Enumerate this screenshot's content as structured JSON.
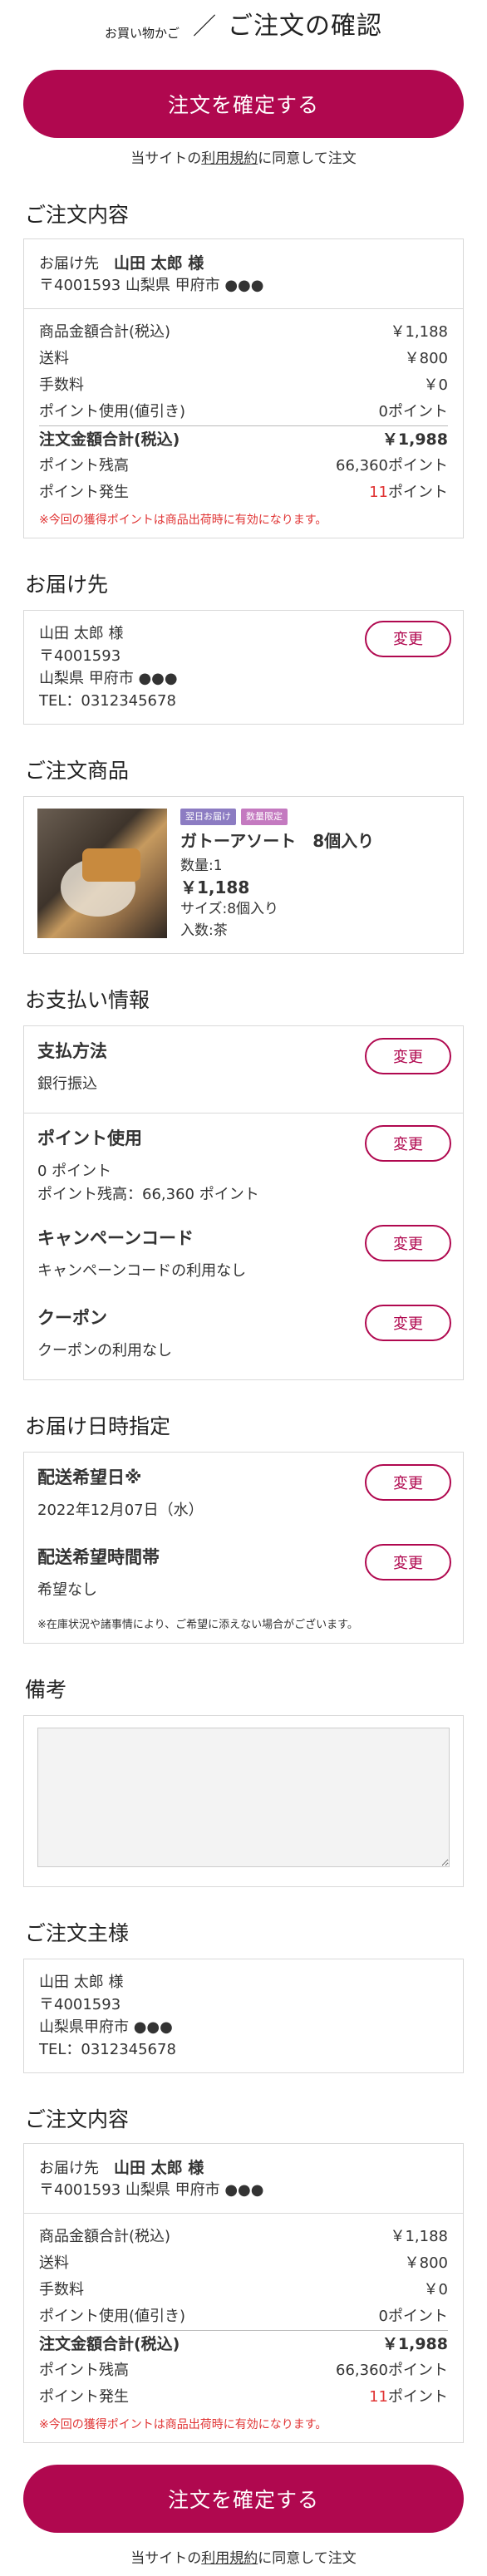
{
  "header": {
    "crumb": "お買い物かご",
    "separator": "／",
    "title": "ご注文の確認"
  },
  "confirm_button": "注文を確定する",
  "agree": {
    "prefix": "当サイトの",
    "link": "利用規約",
    "suffix": "に同意して注文"
  },
  "summary_title": "ご注文内容",
  "summary": {
    "recipient_label": "お届け先",
    "recipient_name": "山田 太郎 様",
    "recipient_addr": "〒4001593 山梨県 甲府市 ●●●",
    "rows": [
      {
        "label": "商品金額合計(税込)",
        "value": "￥1,188"
      },
      {
        "label": "送料",
        "value": "￥800"
      },
      {
        "label": "手数料",
        "value": "￥0"
      },
      {
        "label": "ポイント使用(値引き)",
        "value": "0ポイント"
      }
    ],
    "total_label": "注文金額合計(税込)",
    "total_value": "￥1,988",
    "balance_label": "ポイント残高",
    "balance_value": "66,360ポイント",
    "earned_label": "ポイント発生",
    "earned_num": "11",
    "earned_unit": "ポイント",
    "note": "※今回の獲得ポイントは商品出荷時に有効になります。"
  },
  "delivery_title": "お届け先",
  "delivery": {
    "name": "山田 太郎 様",
    "zip": "〒4001593",
    "addr": "山梨県 甲府市 ●●●",
    "tel": "TEL：0312345678",
    "change": "変更"
  },
  "products_title": "ご注文商品",
  "product": {
    "tag1": "翌日お届け",
    "tag2": "数量限定",
    "name": "ガトーアソート　8個入り",
    "qty": "数量:1",
    "price": "￥1,188",
    "size": "サイズ:8個入り",
    "content": "入数:茶"
  },
  "payment_title": "お支払い情報",
  "payment": {
    "method_label": "支払方法",
    "method_value": "銀行振込",
    "point_label": "ポイント使用",
    "point_value": "0 ポイント",
    "point_balance": "ポイント残高：66,360 ポイント",
    "campaign_label": "キャンペーンコード",
    "campaign_value": "キャンペーンコードの利用なし",
    "coupon_label": "クーポン",
    "coupon_value": "クーポンの利用なし",
    "change": "変更"
  },
  "schedule_title": "お届け日時指定",
  "schedule": {
    "date_label": "配送希望日※",
    "date_value": "2022年12月07日（水）",
    "time_label": "配送希望時間帯",
    "time_value": "希望なし",
    "note": "※在庫状況や諸事情により、ご希望に添えない場合がございます。",
    "change": "変更"
  },
  "remarks_title": "備考",
  "orderer_title": "ご注文主様",
  "orderer": {
    "name": "山田 太郎 様",
    "zip": "〒4001593",
    "addr": "山梨県甲府市 ●●●",
    "tel": "TEL：0312345678"
  }
}
